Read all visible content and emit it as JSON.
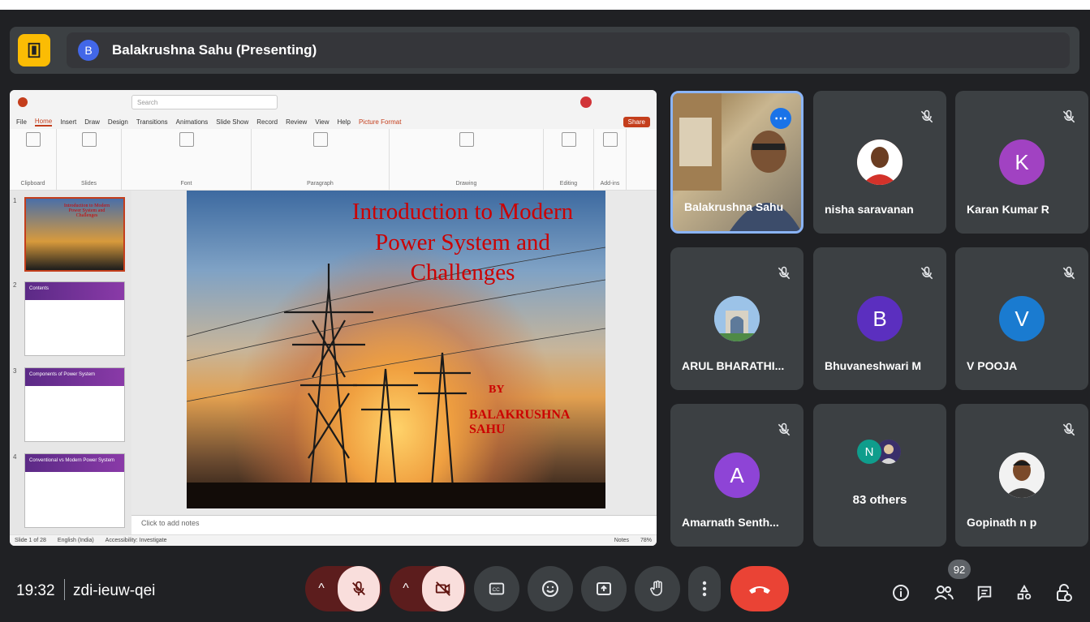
{
  "meeting": {
    "presenter_initial": "B",
    "presenter_label": "Balakrushna Sahu (Presenting)",
    "time": "19:32",
    "code": "zdi-ieuw-qei",
    "participants_badge": "92"
  },
  "ppt": {
    "tabs": [
      "File",
      "Home",
      "Insert",
      "Draw",
      "Design",
      "Transitions",
      "Animations",
      "Slide Show",
      "Record",
      "Review",
      "View",
      "Help",
      "Picture Format"
    ],
    "share_label": "Share",
    "search_placeholder": "Search",
    "ribbon_groups": [
      "Clipboard",
      "Slides",
      "Font",
      "Paragraph",
      "Drawing",
      "Editing",
      "Add-ins"
    ],
    "slide_title": "Introduction to Modern Power System and Challenges",
    "slide_by": "BY",
    "slide_author": "BALAKRUSHNA SAHU",
    "notes_placeholder": "Click to add notes",
    "status_slide": "Slide 1 of 28",
    "status_lang": "English (India)",
    "status_access": "Accessibility: Investigate",
    "status_notes": "Notes",
    "status_zoom": "78%",
    "thumb_numbers": [
      "1",
      "2",
      "3",
      "4"
    ],
    "thumb_titles": [
      "Introduction to Modern Power System and Challenges",
      "Contents",
      "Components of Power System",
      "Conventional vs Modern Power System"
    ]
  },
  "tiles": [
    {
      "name": "Balakrushna Sahu",
      "type": "video"
    },
    {
      "name": "nisha saravanan",
      "type": "photo",
      "muted": true
    },
    {
      "name": "Karan Kumar R",
      "type": "initial",
      "initial": "K",
      "color": "#a142c2",
      "muted": true
    },
    {
      "name": "ARUL BHARATHI...",
      "type": "photo",
      "muted": true
    },
    {
      "name": "Bhuvaneshwari M",
      "type": "initial",
      "initial": "B",
      "color": "#5b2fbf",
      "muted": true
    },
    {
      "name": "V POOJA",
      "type": "initial",
      "initial": "V",
      "color": "#1a7bd0",
      "muted": true
    },
    {
      "name": "Amarnath Senth...",
      "type": "initial",
      "initial": "A",
      "color": "#8e44d6",
      "muted": true
    },
    {
      "name": "83 others",
      "type": "others",
      "initial": "N",
      "color": "#0f9d8c"
    },
    {
      "name": "Gopinath n p",
      "type": "photo",
      "muted": true
    }
  ],
  "icons": {
    "door": "door-icon",
    "mic_off": "mic-off-icon",
    "cam_off": "camera-off-icon",
    "captions": "captions-icon",
    "emoji": "emoji-icon",
    "present": "present-icon",
    "hand": "raise-hand-icon",
    "more": "more-vert-icon",
    "hangup": "call-end-icon",
    "info": "info-icon",
    "people": "people-icon",
    "chat": "chat-icon",
    "activities": "activities-icon",
    "lock": "host-controls-icon"
  }
}
